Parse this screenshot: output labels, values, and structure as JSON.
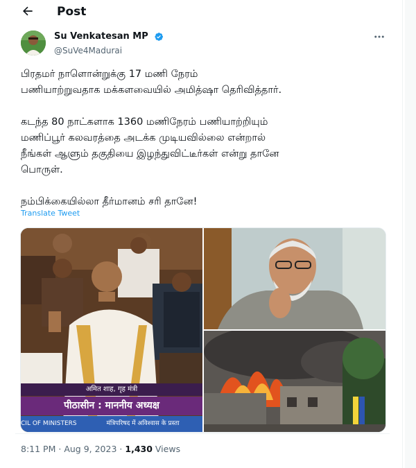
{
  "header": {
    "title": "Post",
    "back_icon": "arrow-left-icon"
  },
  "author": {
    "name": "Su Venkatesan MP",
    "handle": "@SuVe4Madurai",
    "verified_color": "#1d9bf0"
  },
  "tweet": {
    "lines_para1": [
      "பிரதமர் நாளொன்றுக்கு 17 மணி நேரம்",
      "பணியாற்றுவதாக மக்களவையில் அமித்ஷா தெரிவித்தார்."
    ],
    "lines_para2": [
      "கடந்த 80 நாட்களாக 1360 மணிநேரம் பணியாற்றியும்",
      "மணிப்பூர் கலவரத்தை அடக்க முடியவில்லை என்றால்",
      "நீங்கள் ஆளும் தகுதியை இழந்துவிட்டீர்கள் என்று தானே",
      "பொருள்."
    ],
    "lines_para3": [
      "நம்பிக்கையில்லா தீர்மானம் சரி தானே!"
    ],
    "translate_label": "Translate Tweet"
  },
  "media": {
    "caption_name": "अमित शाह, गृह मंत्री",
    "caption_title": "पीठासीन : माननीय अध्यक्ष",
    "caption_ticker_left": "CIL OF MINISTERS",
    "caption_ticker_right": "मंत्रिपरिषद में अविश्वास के प्रस्ता"
  },
  "meta": {
    "time": "8:11 PM",
    "separator": "·",
    "date": "Aug 9, 2023",
    "views_count": "1,430",
    "views_label": "Views"
  }
}
